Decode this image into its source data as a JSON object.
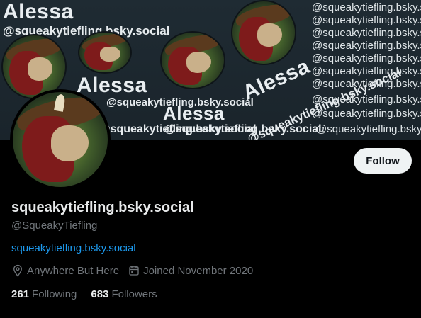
{
  "banner": {
    "name_text": "Alessa",
    "handle_text": "@squeakytiefling.bsky.social"
  },
  "profile": {
    "display_name": "squeakytiefling.bsky.social",
    "handle": "@SqueakyTiefling",
    "website": "squeakytiefling.bsky.social",
    "location": "Anywhere But Here",
    "joined": "Joined November 2020",
    "following_count": "261",
    "following_label": "Following",
    "followers_count": "683",
    "followers_label": "Followers"
  },
  "actions": {
    "follow_label": "Follow"
  },
  "icons": {
    "location": "location-pin-icon",
    "calendar": "calendar-icon"
  },
  "colors": {
    "background": "#000000",
    "link": "#1d9bf0",
    "muted": "#71767b",
    "button_bg": "#eff3f4"
  }
}
